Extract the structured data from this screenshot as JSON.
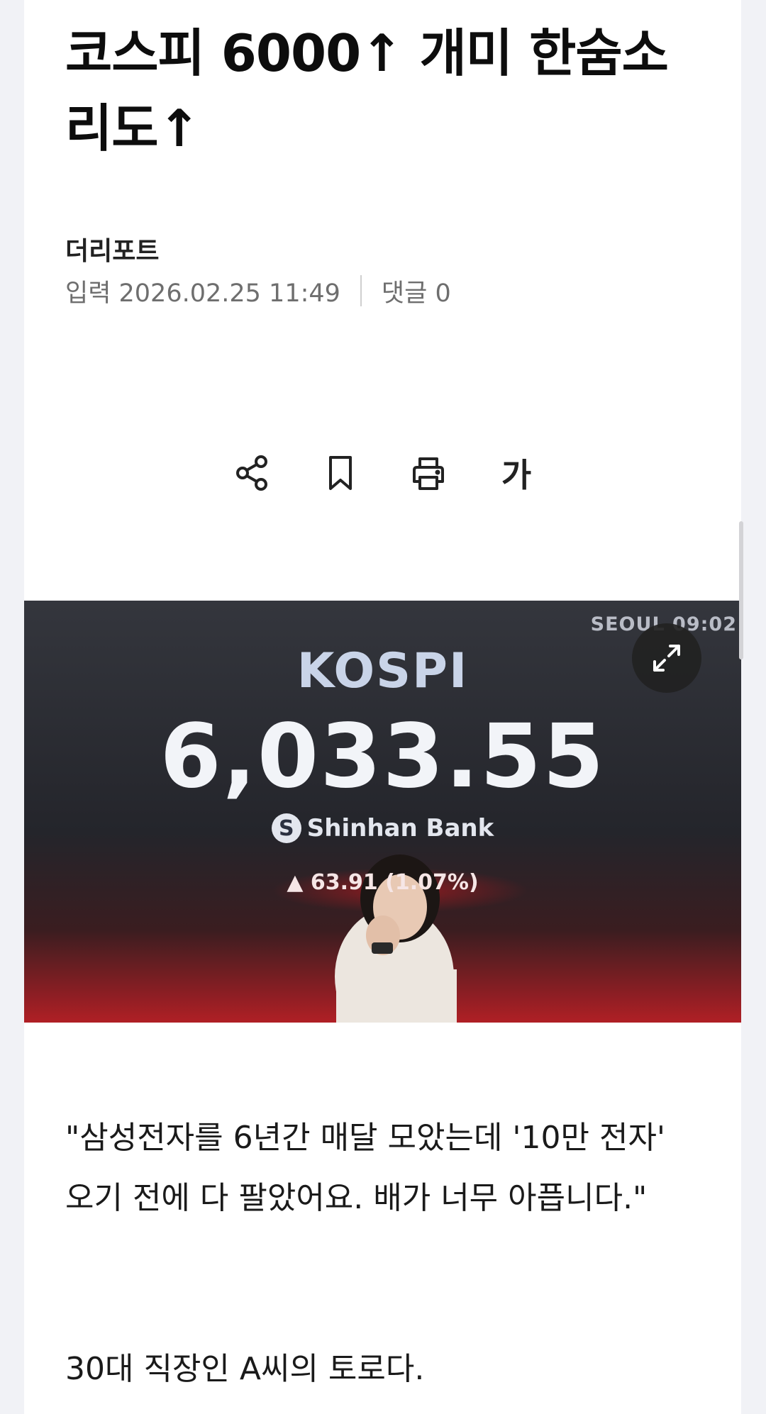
{
  "article": {
    "title": "코스피 6000↑ 개미 한숨소리도↑",
    "press": "더리포트",
    "published": "입력 2026.02.25 11:49",
    "comments": "댓글 0"
  },
  "toolbar": {
    "share_icon": "share-icon",
    "bookmark_icon": "bookmark-icon",
    "print_icon": "print-icon",
    "font_size_label": "가"
  },
  "photo": {
    "seoul_clock": "SEOUL 09:02",
    "index_name": "KOSPI",
    "index_value": "6,033.55",
    "bank": "Shinhan Bank",
    "change": "▲ 63.91 (1.07%)",
    "expand_icon": "expand-icon"
  },
  "body": {
    "paragraph_1": "\"삼성전자를 6년간 매달 모았는데 '10만 전자' 오기 전에 다 팔았어요. 배가 너무 아픕니다.\"",
    "paragraph_2": "30대 직장인 A씨의 토로다."
  },
  "colors": {
    "page_bg": "#f1f2f6",
    "card_bg": "#ffffff",
    "meta_text": "#6e6e6e",
    "photo_dark": "#2a2c33",
    "photo_red": "#b01f25"
  }
}
